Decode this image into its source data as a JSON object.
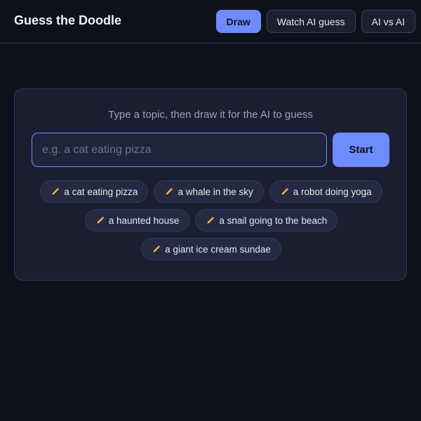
{
  "header": {
    "title": "Guess the Doodle",
    "nav": [
      {
        "label": "Draw",
        "active": true
      },
      {
        "label": "Watch AI guess",
        "active": false
      },
      {
        "label": "AI vs AI",
        "active": false
      }
    ]
  },
  "main": {
    "prompt": "Type a topic, then draw it for the AI to guess",
    "input": {
      "placeholder": "e.g. a cat eating pizza",
      "value": ""
    },
    "start_label": "Start",
    "suggestions": [
      "a cat eating pizza",
      "a whale in the sky",
      "a robot doing yoga",
      "a haunted house",
      "a snail going to the beach",
      "a giant ice cream sundae"
    ],
    "suggestion_icon": "pencil-icon"
  },
  "colors": {
    "background": "#0f111a",
    "accent": "#6e8bff",
    "card": "#1b1e31",
    "chip": "#252a42"
  }
}
